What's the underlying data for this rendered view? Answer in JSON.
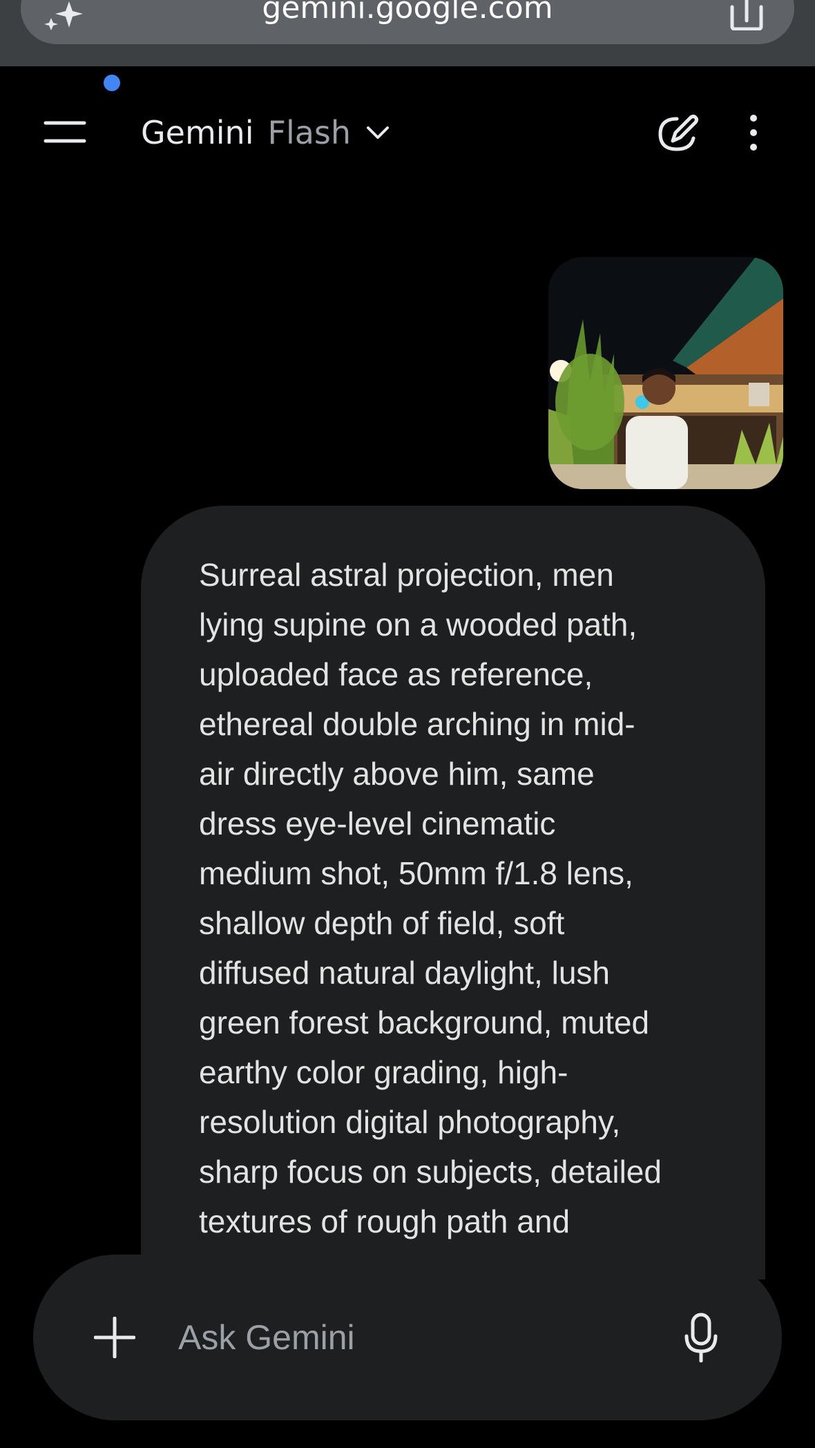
{
  "browser": {
    "url": "gemini.google.com",
    "sparkle_icon": "sparkle-icon",
    "share_icon": "share-icon"
  },
  "header": {
    "title": "Gemini",
    "model": "Flash",
    "menu_icon": "hamburger-menu-icon",
    "model_dropdown_icon": "chevron-down-icon",
    "new_chat_icon": "edit-pen-icon",
    "more_icon": "more-vertical-icon"
  },
  "conversation": {
    "user_image_alt": "Uploaded photo of a man in front of a lit building at night",
    "user_prompt": "Surreal astral projection, men\nlying supine on a wooded path,\nuploaded face as reference,\nethereal double arching in mid-\nair directly above him, same\ndress eye-level cinematic\nmedium shot, 50mm f/1.8 lens,\nshallow depth of field, soft\ndiffused natural daylight, lush\ngreen forest background, muted\nearthy color grading, high-\nresolution digital photography,\nsharp focus on subjects, detailed\ntextures of rough path and"
  },
  "composer": {
    "placeholder": "Ask Gemini",
    "add_icon": "plus-icon",
    "mic_icon": "microphone-icon"
  },
  "colors": {
    "background": "#000000",
    "browser_bar": "#3c4043",
    "url_pill": "#5f6368",
    "bubble": "#1e1f20",
    "accent_dot": "#4285f4",
    "muted_text": "#9aa0a6"
  }
}
